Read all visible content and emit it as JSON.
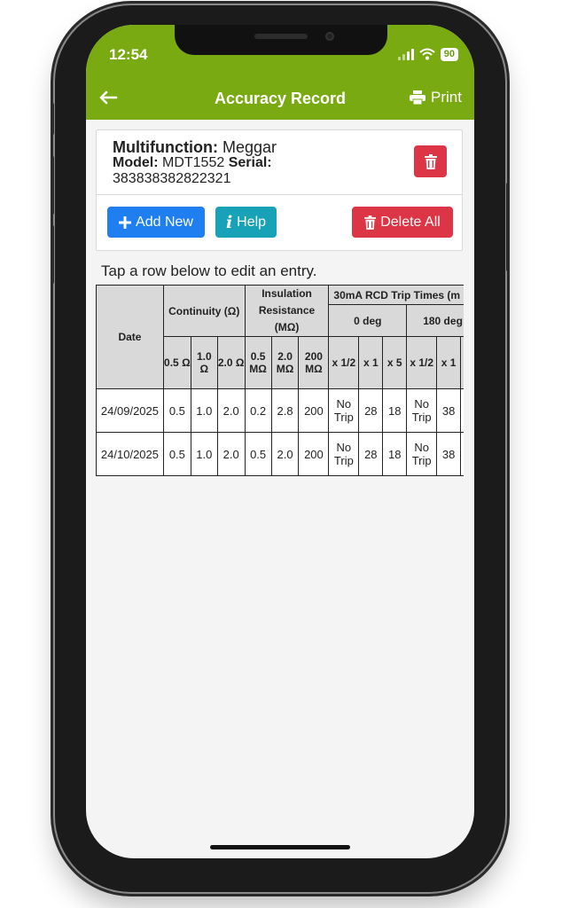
{
  "status_bar": {
    "time": "12:54",
    "battery": "90"
  },
  "header": {
    "back_icon": "arrow-left-icon",
    "title": "Accuracy Record",
    "print_label": "Print"
  },
  "instrument": {
    "multifunction_label": "Multifunction:",
    "multifunction_value": "Meggar",
    "model_label": "Model:",
    "model_value": "MDT1552",
    "serial_label": "Serial:",
    "serial_value": "383838382822321"
  },
  "actions": {
    "add_new": "Add New",
    "help": "Help",
    "delete_all": "Delete All"
  },
  "hint": "Tap a row below to edit an entry.",
  "table": {
    "date_header": "Date",
    "continuity_header": "Continuity (Ω)",
    "insulation_header": "Insulation Resistance (MΩ)",
    "rcd_header": "30mA RCD Trip Times (m",
    "deg0_header": "0 deg",
    "deg180_header": "180 deg",
    "sub_headers": [
      "0.5 Ω",
      "1.0 Ω",
      "2.0 Ω",
      "0.5 MΩ",
      "2.0 MΩ",
      "200 MΩ",
      "x 1/2",
      "x 1",
      "x 5",
      "x 1/2",
      "x 1"
    ],
    "rows": [
      [
        "24/09/2025",
        "0.5",
        "1.0",
        "2.0",
        "0.2",
        "2.8",
        "200",
        "No Trip",
        "28",
        "18",
        "No Trip",
        "38"
      ],
      [
        "24/10/2025",
        "0.5",
        "1.0",
        "2.0",
        "0.5",
        "2.0",
        "200",
        "No Trip",
        "28",
        "18",
        "No Trip",
        "38"
      ]
    ]
  },
  "colors": {
    "header": "#7aaa11",
    "primary": "#1f7ff0",
    "info": "#17a2b8",
    "danger": "#dc3545"
  }
}
